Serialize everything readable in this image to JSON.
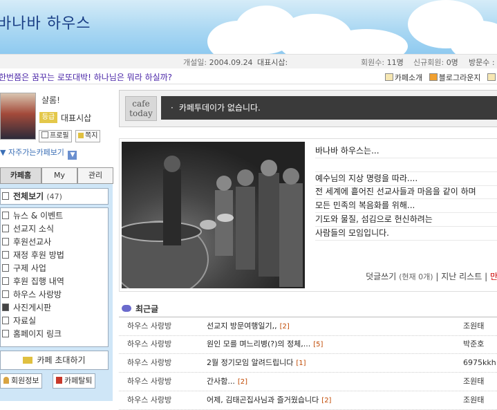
{
  "cafe": {
    "title": "바나바 하우스",
    "founded_label": "개설일:",
    "founded": "2004.09.24",
    "rep_label": "대표시삽:",
    "members_label": "회원수:",
    "members": "11명",
    "new_members_label": "신규회원:",
    "new_members": "0명",
    "visitors_label": "방문수 :"
  },
  "slogan": "한번쯤은 꿈꾸는 로또대박! 하나님은 뭐라 하실까?",
  "toplinks": [
    "카페소개",
    "블로그라운지"
  ],
  "profile": {
    "greeting": "샬롬!",
    "grade": "등급",
    "nickname": "대표시삽",
    "profile_btn": "프로필",
    "message_btn": "쪽지",
    "favorites": "자주가는카페보기"
  },
  "tabs": [
    "카페홈",
    "My",
    "관리"
  ],
  "menu": {
    "all_label": "전체보기",
    "all_count": "(47)",
    "items": [
      "뉴스 & 이벤트",
      "선교지 소식",
      "후원선교사",
      "재정 후원 방법",
      "구제 사업",
      "후원 집행 내역",
      "하우스 사랑방",
      "사진게시판",
      "자료실",
      "홈페이지 링크"
    ],
    "invite": "카페 초대하기",
    "member_info": "회원정보",
    "leave": "카페탈퇴"
  },
  "today": {
    "logo_line1": "cafe",
    "logo_line2": "today",
    "message": "카페투데이가 없습니다."
  },
  "intro": {
    "lines": [
      "바나바 하우스는...",
      "",
      "예수님의 지상 명령을 따라....",
      "전 세계에 흩어진 선교사들과 마음을 같이 하며",
      "모든 민족의 복음화를 위해...",
      "기도와 물질, 섬김으로 헌신하려는",
      "사람들의 모임입니다."
    ],
    "comment": "덧글쓰기",
    "comment_count": "(현재 0개)",
    "past_list": "지난 리스트",
    "more": "만"
  },
  "recent": {
    "title": "최근글",
    "rows": [
      {
        "board": "하우스 사랑방",
        "title": "선교지 방문여행일기,,",
        "count": "[2]",
        "author": "조원태"
      },
      {
        "board": "하우스 사랑방",
        "title": "원인 모를 며느리병(?)의 정체,...",
        "count": "[5]",
        "author": "박준호"
      },
      {
        "board": "하우스 사랑방",
        "title": "2월 정기모임 알려드립니다",
        "count": "[1]",
        "author": "6975kkh"
      },
      {
        "board": "하우스 사랑방",
        "title": "간사함...",
        "count": "[2]",
        "author": "조원태"
      },
      {
        "board": "하우스 사랑방",
        "title": "어제, 김태곤집사님과 즐거웠습니다",
        "count": "[2]",
        "author": "조원태"
      }
    ]
  },
  "colors": {
    "slogan": "#4b27a8",
    "title": "#1a3f86",
    "side_panel": "#cfe6f7"
  }
}
